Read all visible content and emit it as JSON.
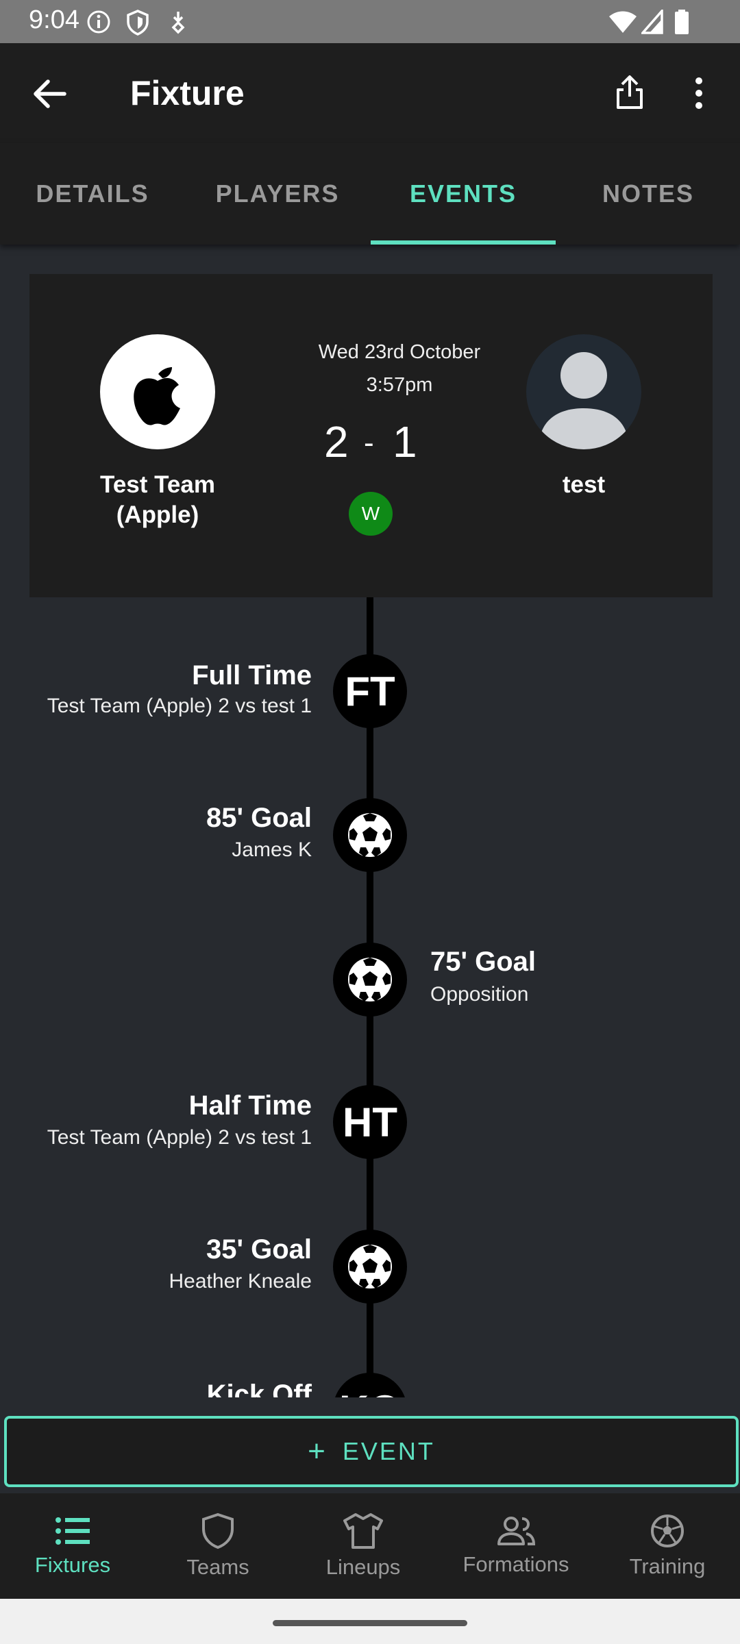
{
  "status_bar": {
    "time": "9:04"
  },
  "app_bar": {
    "title": "Fixture"
  },
  "tabs": [
    {
      "label": "DETAILS",
      "active": false
    },
    {
      "label": "PLAYERS",
      "active": false
    },
    {
      "label": "EVENTS",
      "active": true
    },
    {
      "label": "NOTES",
      "active": false
    }
  ],
  "fixture": {
    "home_team": "Test Team (Apple)",
    "away_team": "test",
    "date": "Wed 23rd October",
    "time": "3:57pm",
    "home_score": "2",
    "score_separator": "-",
    "away_score": "1",
    "result_badge": "W"
  },
  "events": [
    {
      "title": "Full Time",
      "subtitle": "Test Team (Apple) 2 vs test 1",
      "icon": "FT",
      "side": "left"
    },
    {
      "title": "85' Goal",
      "subtitle": "James K",
      "icon": "ball-icon",
      "side": "left"
    },
    {
      "title": "75' Goal",
      "subtitle": "Opposition",
      "icon": "ball-icon",
      "side": "right"
    },
    {
      "title": "Half Time",
      "subtitle": "Test Team (Apple) 2 vs test 1",
      "icon": "HT",
      "side": "left"
    },
    {
      "title": "35' Goal",
      "subtitle": "Heather Kneale",
      "icon": "ball-icon",
      "side": "left"
    },
    {
      "title": "Kick Off",
      "subtitle": "",
      "icon": "KO",
      "side": "left"
    }
  ],
  "add_event_button": {
    "plus": "+",
    "label": "EVENT"
  },
  "bottom_nav": [
    {
      "label": "Fixtures",
      "icon": "list-icon",
      "active": true
    },
    {
      "label": "Teams",
      "icon": "shield-icon",
      "active": false
    },
    {
      "label": "Lineups",
      "icon": "shirt-icon",
      "active": false
    },
    {
      "label": "Formations",
      "icon": "people-icon",
      "active": false
    },
    {
      "label": "Training",
      "icon": "ball-icon",
      "active": false
    }
  ],
  "colors": {
    "accent": "#5ee0c0",
    "background": "#272a2f",
    "surface": "#1e1e1e",
    "win_badge": "#0f8a17"
  }
}
